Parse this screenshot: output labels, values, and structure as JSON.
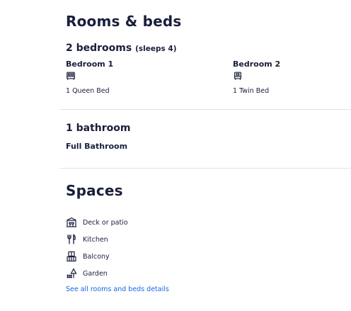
{
  "rooms_section": {
    "title": "Rooms & beds",
    "bedrooms_heading": "2 bedrooms",
    "bedrooms_sleeps": "(sleeps 4)",
    "bedrooms": [
      {
        "name": "Bedroom 1",
        "icon": "bed-icon",
        "beds": "1 Queen Bed"
      },
      {
        "name": "Bedroom 2",
        "icon": "bed-icon",
        "beds": "1 Twin Bed"
      }
    ],
    "bathrooms_heading": "1 bathroom",
    "bathroom_type": "Full Bathroom"
  },
  "spaces_section": {
    "title": "Spaces",
    "items": [
      {
        "label": "Deck or patio",
        "icon": "deck-patio-icon"
      },
      {
        "label": "Kitchen",
        "icon": "kitchen-utensils-icon"
      },
      {
        "label": "Balcony",
        "icon": "balcony-icon"
      },
      {
        "label": "Garden",
        "icon": "garden-icon"
      }
    ],
    "details_link": "See all rooms and beds details"
  },
  "colors": {
    "text": "#191e3b",
    "link": "#1668e3",
    "divider": "#e3e3e8"
  }
}
